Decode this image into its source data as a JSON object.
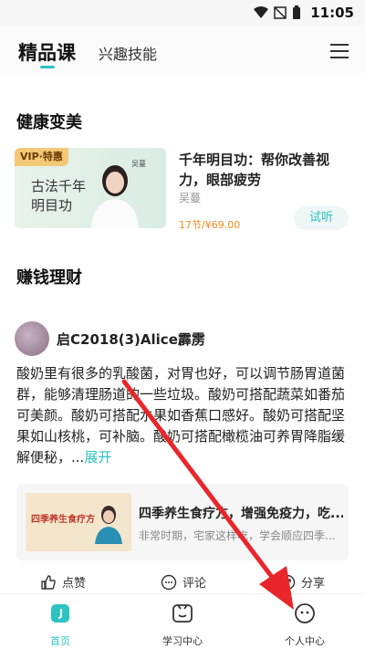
{
  "status_bar": {
    "time": "11:05"
  },
  "top_nav": {
    "tabs": [
      {
        "label": "精品课"
      },
      {
        "label": "兴趣技能"
      }
    ]
  },
  "sections": {
    "health": "健康变美",
    "money": "赚钱理财"
  },
  "course": {
    "vip_badge": "VIP·特惠",
    "thumb_title": "古法千年明目功",
    "thumb_author": "吴蔓",
    "title": "千年明目功：帮你改善视力，眼部疲劳",
    "author": "吴蔓",
    "price": "17节/¥69.00",
    "listen_label": "试听"
  },
  "post": {
    "username": "启C2018(3)Alice霹雳",
    "text": "酸奶里有很多的乳酸菌，对胃也好，可以调节肠胃道菌群，能够清理肠道的一些垃圾。酸奶可搭配蔬菜如番茄可美颜。酸奶可搭配水果如香蕉口感好。酸奶可搭配坚果如山核桃，可补脑。酸奶可搭配橄榄油可养胃降脂缓解便秘，...",
    "expand_label": "展开",
    "linked": {
      "thumb_title": "四季养生食疗方",
      "title": "四季养生食疗方，增强免疫力，吃...",
      "subtitle": "非常时期，宅家这样吃，学会顺应四季..."
    },
    "actions": {
      "like": "点赞",
      "comment": "评论",
      "share": "分享"
    }
  },
  "bottom_nav": {
    "items": [
      {
        "label": "首页"
      },
      {
        "label": "学习中心"
      },
      {
        "label": "个人中心"
      }
    ]
  },
  "colors": {
    "accent": "#2dc3c2",
    "price": "#f08a1d",
    "annotation_arrow": "#e8262b"
  }
}
